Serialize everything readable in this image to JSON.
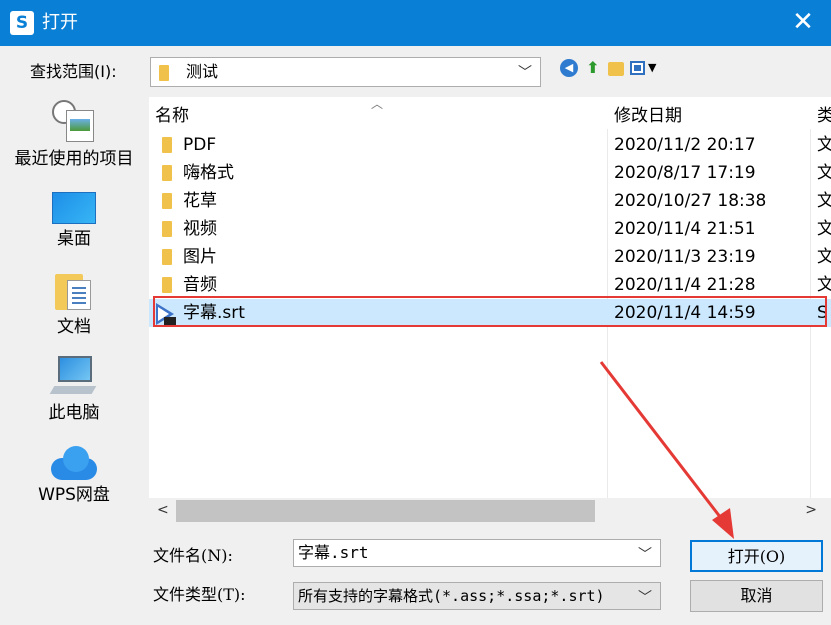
{
  "window": {
    "title": "打开",
    "icon": "wps-app-icon",
    "close_glyph": "✕"
  },
  "lookin": {
    "label": "查找范围(I):",
    "value": "测试"
  },
  "toolbar": {
    "icons": [
      "back-icon",
      "up-folder-icon",
      "new-folder-icon",
      "view-menu-icon"
    ]
  },
  "sidebar": {
    "items": [
      {
        "label": "最近使用的项目",
        "icon": "recent-items-icon"
      },
      {
        "label": "桌面",
        "icon": "desktop-icon"
      },
      {
        "label": "文档",
        "icon": "documents-icon"
      },
      {
        "label": "此电脑",
        "icon": "this-pc-icon"
      },
      {
        "label": "WPS网盘",
        "icon": "cloud-drive-icon"
      }
    ]
  },
  "filelist": {
    "columns": {
      "name": "名称",
      "date": "修改日期",
      "type": "类"
    },
    "rows": [
      {
        "name": "PDF",
        "date": "2020/11/2 20:17",
        "type": "文"
      },
      {
        "name": "嗨格式",
        "date": "2020/8/17 17:19",
        "type": "文"
      },
      {
        "name": "花草",
        "date": "2020/10/27 18:38",
        "type": "文"
      },
      {
        "name": "视频",
        "date": "2020/11/4 21:51",
        "type": "文"
      },
      {
        "name": "图片",
        "date": "2020/11/3 23:19",
        "type": "文"
      },
      {
        "name": "音频",
        "date": "2020/11/4 21:28",
        "type": "文"
      },
      {
        "name": "字幕.srt",
        "date": "2020/11/4 14:59",
        "type": "S",
        "selected": true
      }
    ]
  },
  "filename": {
    "label": "文件名(N):",
    "value": "字幕.srt"
  },
  "filetype": {
    "label": "文件类型(T):",
    "value": "所有支持的字幕格式(*.ass;*.ssa;*.srt)"
  },
  "buttons": {
    "open": "打开(O)",
    "cancel": "取消"
  },
  "colors": {
    "titlebar": "#0a7fd6",
    "selection": "#cce8ff",
    "highlight": "#e53935"
  }
}
